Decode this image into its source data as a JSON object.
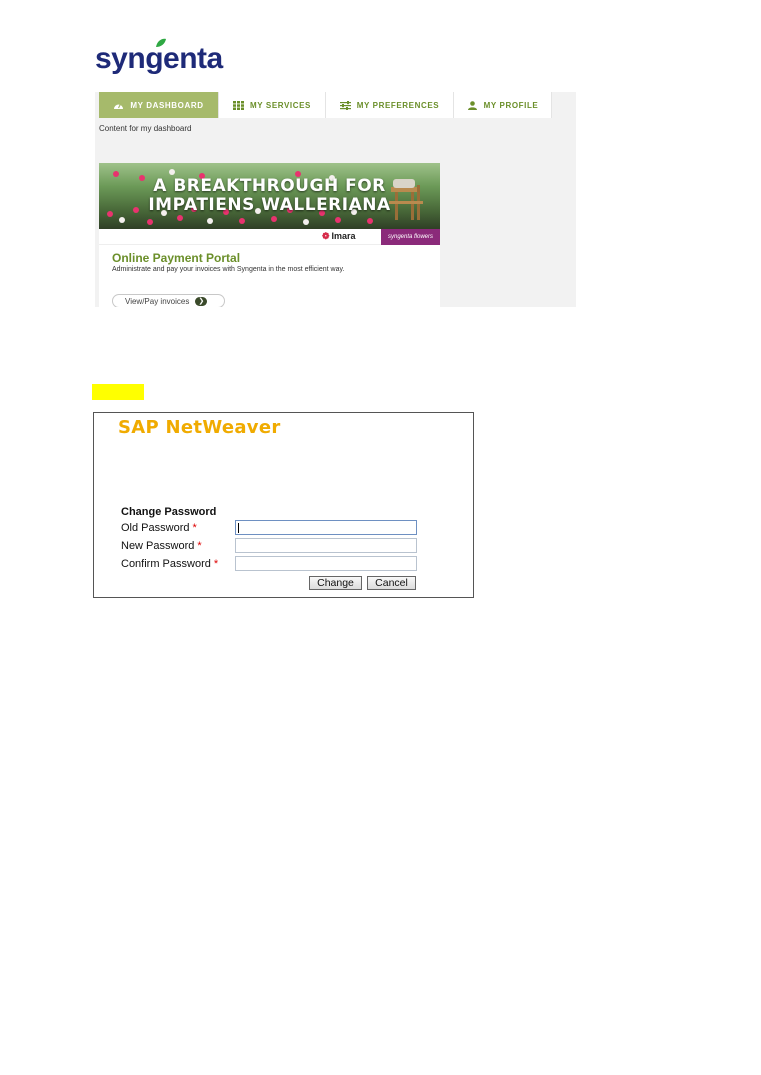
{
  "logo": {
    "text": "syngenta",
    "leaf_color": "#2fa843",
    "text_color": "#1e2a78"
  },
  "dashboard": {
    "nav": [
      {
        "label": "MY DASHBOARD",
        "icon": "gauge-icon",
        "active": true
      },
      {
        "label": "MY SERVICES",
        "icon": "grid-icon",
        "active": false
      },
      {
        "label": "MY PREFERENCES",
        "icon": "sliders-icon",
        "active": false
      },
      {
        "label": "MY PROFILE",
        "icon": "user-icon",
        "active": false
      }
    ],
    "caption": "Content for my dashboard",
    "card": {
      "banner_line1": "A BREAKTHROUGH FOR",
      "banner_line2": "IMPATIENS WALLERIANA",
      "brand_imara": "Imara",
      "brand_sf": "syngenta flowers",
      "title": "Online Payment Portal",
      "description": "Administrate and pay your invoices with Syngenta in the most efficient way.",
      "button": "View/Pay invoices"
    },
    "accent": "#6b8f2a",
    "active_tab_color": "#a6ba6b"
  },
  "sap": {
    "logo": "SAP NetWeaver",
    "heading": "Change Password",
    "old_label": "Old Password",
    "new_label": "New Password",
    "confirm_label": "Confirm Password",
    "required_mark": "*",
    "change_button": "Change",
    "cancel_button": "Cancel",
    "logo_color": "#f0ab00"
  }
}
